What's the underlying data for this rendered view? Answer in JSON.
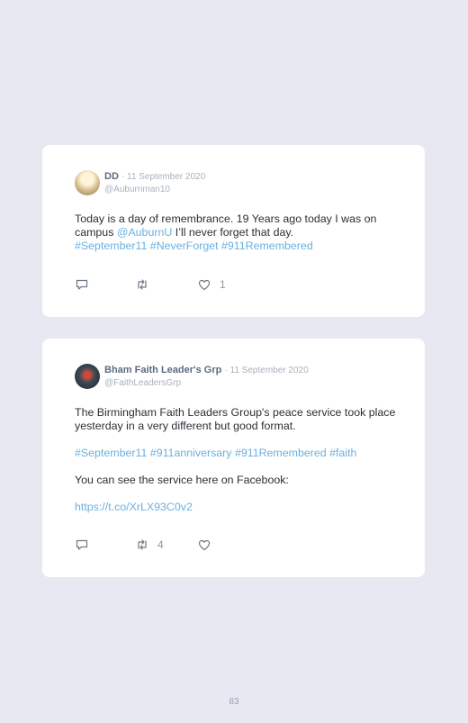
{
  "tweets": [
    {
      "name": "DD",
      "date": "· 11 September 2020",
      "handle": "@Auburnman10",
      "text_a": "Today is a day of remembrance. 19 Years ago today I was on campus ",
      "mention": "@AuburnU",
      "text_b": " I’ll never forget that day.",
      "hashtags": "#September11 #NeverForget #911Remembered",
      "replies": "",
      "retweets": "",
      "likes": "1"
    },
    {
      "name": "Bham Faith Leader's Grp",
      "date": "· 11 September 2020",
      "handle": "@FaithLeadersGrp",
      "p1": "The Birmingham Faith Leaders Group's peace service took place yesterday in a very different but good format.",
      "hashtags": "#September11 #911anniversary #911Remembered #faith",
      "p3": "You can see the service here on Facebook:",
      "url": "https://t.co/XrLX93C0v2",
      "replies": "",
      "retweets": "4",
      "likes": ""
    }
  ],
  "icons": [
    "reply-icon",
    "retweet-icon",
    "like-icon"
  ],
  "colors": {
    "background": "#e7e8f1",
    "link": "#6ab0de",
    "name": "#5b6b80"
  },
  "page_number": "83"
}
